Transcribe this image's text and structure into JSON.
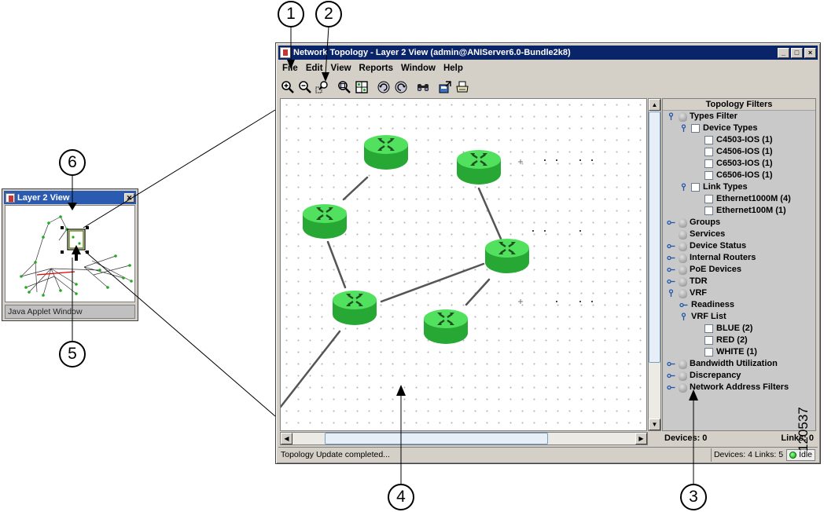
{
  "window": {
    "title": "Network Topology - Layer 2 View (admin@ANIServer6.0-Bundle2k8)",
    "controls": [
      "_",
      "□",
      "×"
    ]
  },
  "menu": [
    "File",
    "Edit",
    "View",
    "Reports",
    "Window",
    "Help"
  ],
  "toolbar": {
    "icons": [
      "zoom-in-icon",
      "zoom-out-icon",
      "zoom-region-icon",
      "zoom-fit-icon",
      "fit-all-icon",
      "rotate-left-icon",
      "rotate-right-icon",
      "find-icon",
      "export-icon",
      "print-icon"
    ]
  },
  "filters": {
    "header": "Topology Filters",
    "items": [
      {
        "label": "Types Filter",
        "level": 0,
        "kind": "bulb",
        "expanded": true
      },
      {
        "label": "Device Types",
        "level": 1,
        "kind": "check",
        "expanded": true
      },
      {
        "label": "C4503-IOS (1)",
        "level": 2,
        "kind": "check"
      },
      {
        "label": "C4506-IOS (1)",
        "level": 2,
        "kind": "check"
      },
      {
        "label": "C6503-IOS (1)",
        "level": 2,
        "kind": "check"
      },
      {
        "label": "C6506-IOS (1)",
        "level": 2,
        "kind": "check"
      },
      {
        "label": "Link Types",
        "level": 1,
        "kind": "check",
        "expanded": true
      },
      {
        "label": "Ethernet1000M (4)",
        "level": 2,
        "kind": "check"
      },
      {
        "label": "Ethernet100M (1)",
        "level": 2,
        "kind": "check"
      },
      {
        "label": "Groups",
        "level": 0,
        "kind": "bulb",
        "expanded": false
      },
      {
        "label": "Services",
        "level": 0,
        "kind": "bulb"
      },
      {
        "label": "Device Status",
        "level": 0,
        "kind": "bulb",
        "expanded": false
      },
      {
        "label": "Internal Routers",
        "level": 0,
        "kind": "bulb",
        "expanded": false
      },
      {
        "label": "PoE Devices",
        "level": 0,
        "kind": "bulb",
        "expanded": false
      },
      {
        "label": "TDR",
        "level": 0,
        "kind": "bulb",
        "expanded": false
      },
      {
        "label": "VRF",
        "level": 0,
        "kind": "bulb",
        "expanded": true
      },
      {
        "label": "Readiness",
        "level": 1,
        "kind": "none",
        "expanded": false
      },
      {
        "label": "VRF List",
        "level": 1,
        "kind": "none",
        "expanded": true
      },
      {
        "label": "BLUE (2)",
        "level": 2,
        "kind": "check"
      },
      {
        "label": "RED (2)",
        "level": 2,
        "kind": "check"
      },
      {
        "label": "WHITE (1)",
        "level": 2,
        "kind": "check"
      },
      {
        "label": "Bandwidth Utilization",
        "level": 0,
        "kind": "bulb",
        "expanded": false
      },
      {
        "label": "Discrepancy",
        "level": 0,
        "kind": "bulb",
        "expanded": false
      },
      {
        "label": "Network Address Filters",
        "level": 0,
        "kind": "bulb",
        "expanded": false
      }
    ]
  },
  "panel_footer": {
    "devices": "Devices: 0",
    "links": "Links: 0"
  },
  "status": {
    "message": "Topology Update completed...",
    "counts": "Devices: 4 Links: 5",
    "state": "Idle",
    "state_color": "#00aa00"
  },
  "mini_window": {
    "title": "Layer 2 View",
    "status": "Java Applet Window"
  },
  "callouts": [
    "1",
    "2",
    "3",
    "4",
    "5",
    "6"
  ],
  "figure_id": "120537",
  "colors": {
    "router": "#2ec43c",
    "titlebar": "#0a246a",
    "mini_titlebar": "#2a5bb0",
    "panel": "#c9c9c9"
  }
}
